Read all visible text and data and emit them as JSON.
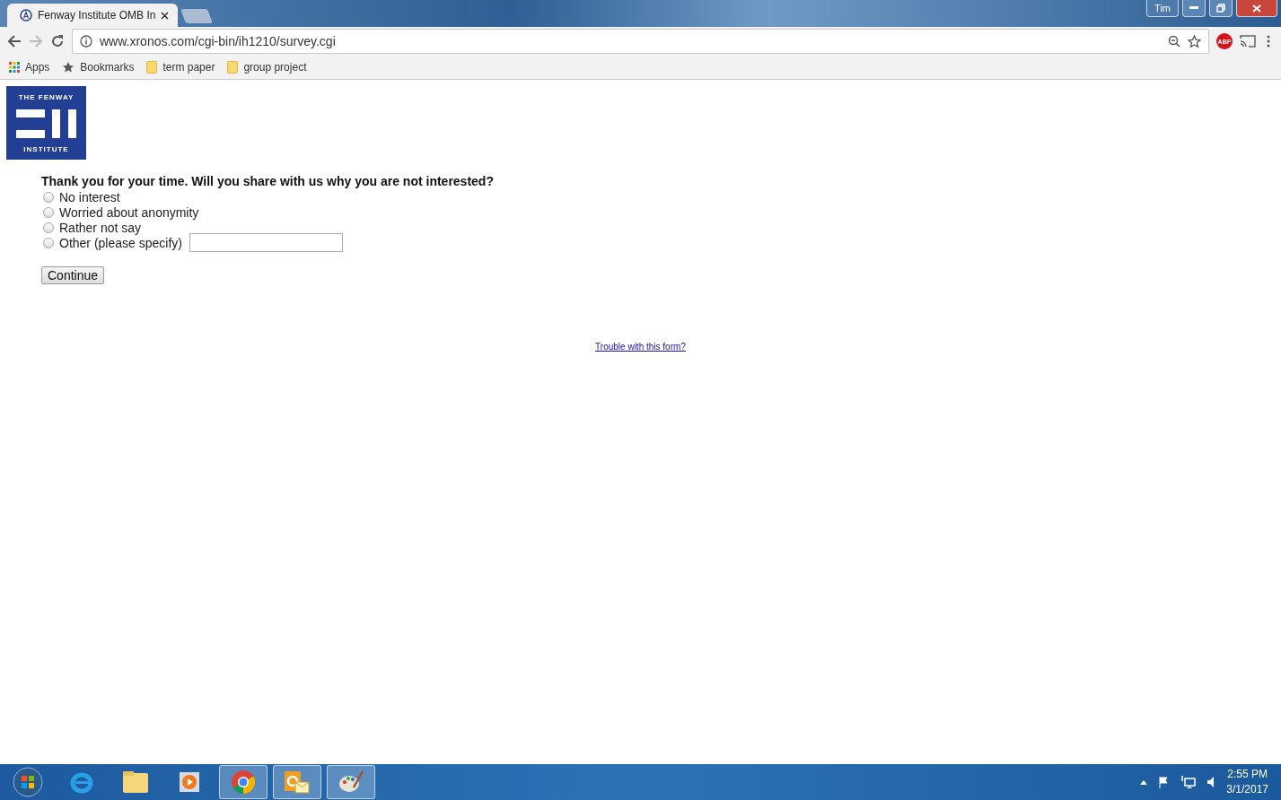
{
  "window": {
    "user": "Tim"
  },
  "tabs": [
    {
      "title": "Fenway Institute OMB In",
      "selected": true
    }
  ],
  "address_bar": {
    "url": "www.xronos.com/cgi-bin/ih1210/survey.cgi"
  },
  "extension": {
    "label": "ABP"
  },
  "bookmarks": [
    {
      "kind": "apps",
      "label": "Apps"
    },
    {
      "kind": "star",
      "label": "Bookmarks"
    },
    {
      "kind": "folder",
      "label": "term paper"
    },
    {
      "kind": "folder",
      "label": "group project"
    }
  ],
  "logo": {
    "top": "THE FENWAY",
    "bottom": "INSTITUTE"
  },
  "form": {
    "question": "Thank you for your time. Will you share with us why you are not interested?",
    "options": [
      {
        "label": "No interest",
        "selected": false
      },
      {
        "label": "Worried about anonymity",
        "selected": false
      },
      {
        "label": "Rather not say",
        "selected": false
      },
      {
        "label": "Other (please specify)",
        "selected": false,
        "kind": "other"
      }
    ],
    "button": "Continue"
  },
  "help_link": "Trouble with this form?",
  "taskbar": {
    "apps": [
      {
        "kind": "ie",
        "open": false
      },
      {
        "kind": "folder",
        "open": false
      },
      {
        "kind": "media",
        "open": false
      },
      {
        "kind": "chrome",
        "open": true
      },
      {
        "kind": "outlook",
        "open": true
      },
      {
        "kind": "paint",
        "open": true
      }
    ],
    "time": "2:55 PM",
    "date": "3/1/2017"
  }
}
